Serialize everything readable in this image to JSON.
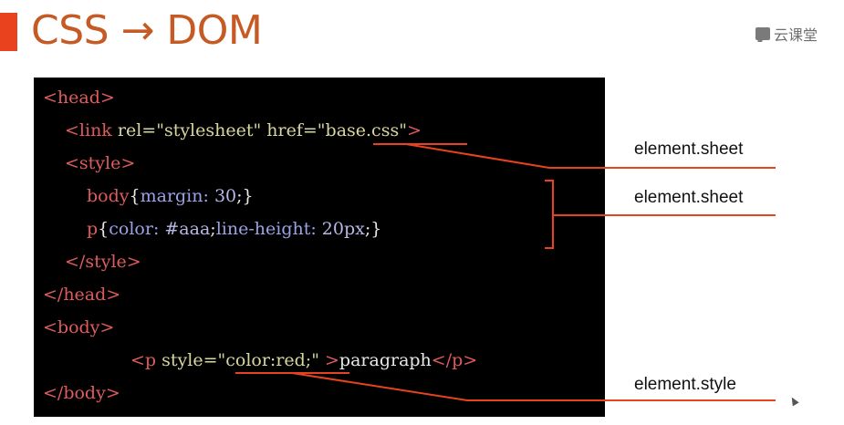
{
  "slide": {
    "title": "CSS → DOM",
    "logo_text": "云课堂",
    "accent_color": "#e8421f",
    "title_color": "#c65a25",
    "highlight_color": "#e8421f"
  },
  "code": {
    "lines": [
      [
        {
          "t": "tag",
          "v": "<head>"
        }
      ],
      [
        {
          "t": "tag",
          "v": "<link"
        },
        {
          "t": "attr",
          "v": " rel="
        },
        {
          "t": "str",
          "v": "\"stylesheet\""
        },
        {
          "t": "attr",
          "v": " href="
        },
        {
          "t": "str",
          "v": "\"base.css\""
        },
        {
          "t": "tag",
          "v": ">"
        }
      ],
      [
        {
          "t": "tag",
          "v": "<style>"
        }
      ],
      [
        {
          "t": "sel",
          "v": "body"
        },
        {
          "t": "punc",
          "v": "{"
        },
        {
          "t": "prop",
          "v": "margin: "
        },
        {
          "t": "num",
          "v": "30"
        },
        {
          "t": "punc",
          "v": ";}"
        }
      ],
      [
        {
          "t": "sel",
          "v": "p"
        },
        {
          "t": "punc",
          "v": "{"
        },
        {
          "t": "prop",
          "v": "color: "
        },
        {
          "t": "num",
          "v": "#aaa"
        },
        {
          "t": "punc",
          "v": ";"
        },
        {
          "t": "prop",
          "v": "line-height: "
        },
        {
          "t": "num",
          "v": "20px"
        },
        {
          "t": "punc",
          "v": ";}"
        }
      ],
      [
        {
          "t": "tag",
          "v": "</style>"
        }
      ],
      [
        {
          "t": "tag",
          "v": "</head>"
        }
      ],
      [
        {
          "t": "tag",
          "v": "<body>"
        }
      ],
      [
        {
          "t": "tag",
          "v": "<p"
        },
        {
          "t": "attr",
          "v": " style="
        },
        {
          "t": "str",
          "v": "\"color:red;\""
        },
        {
          "t": "tag",
          "v": " >"
        },
        {
          "t": "plain",
          "v": "paragraph"
        },
        {
          "t": "tag",
          "v": "</p>"
        }
      ],
      [
        {
          "t": "tag",
          "v": "</body>"
        }
      ]
    ]
  },
  "annotations": {
    "link_label": "element.sheet",
    "style_label": "element.sheet",
    "inline_label": "element.style"
  }
}
